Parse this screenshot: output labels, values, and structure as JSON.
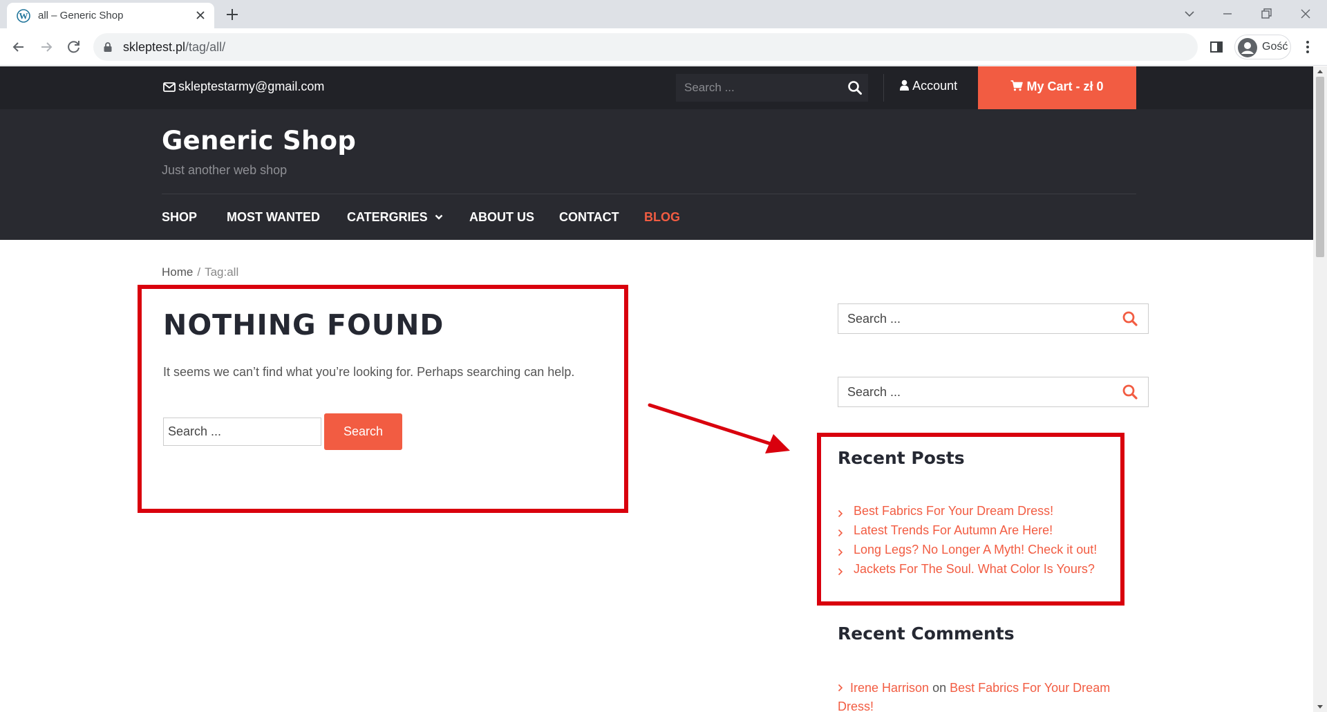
{
  "browser": {
    "tab_title": "all – Generic Shop",
    "url_host": "skleptest.pl",
    "url_path": "/tag/all/",
    "profile_name": "Gość"
  },
  "site": {
    "email": "skleptestarmy@gmail.com",
    "top_search_placeholder": "Search ...",
    "account_label": "Account",
    "cart_label": "My Cart - zł 0",
    "title": "Generic Shop",
    "tagline": "Just another web shop",
    "nav": [
      {
        "label": "SHOP"
      },
      {
        "label": "MOST WANTED"
      },
      {
        "label": "CATERGRIES"
      },
      {
        "label": "ABOUT US"
      },
      {
        "label": "CONTACT"
      },
      {
        "label": "BLOG"
      }
    ],
    "accent_color": "#f25c42"
  },
  "breadcrumb": {
    "home": "Home",
    "separator": "/",
    "current": "Tag:all"
  },
  "main": {
    "heading": "NOTHING FOUND",
    "message": "It seems we can’t find what you’re looking for. Perhaps searching can help.",
    "search_placeholder": "Search ...",
    "search_button": "Search"
  },
  "sidebar": {
    "search_placeholder_1": "Search ...",
    "search_placeholder_2": "Search ...",
    "recent_posts_title": "Recent Posts",
    "recent_posts": [
      "Best Fabrics For Your Dream Dress!",
      "Latest Trends For Autumn Are Here!",
      "Long Legs? No Longer A Myth! Check it out!",
      "Jackets For The Soul. What Color Is Yours?"
    ],
    "recent_comments_title": "Recent Comments",
    "recent_comment": {
      "author": "Irene Harrison",
      "connector": "on",
      "post": "Best Fabrics For Your Dream Dress!"
    }
  },
  "annotations": {
    "highlight_color": "#d9000d"
  }
}
